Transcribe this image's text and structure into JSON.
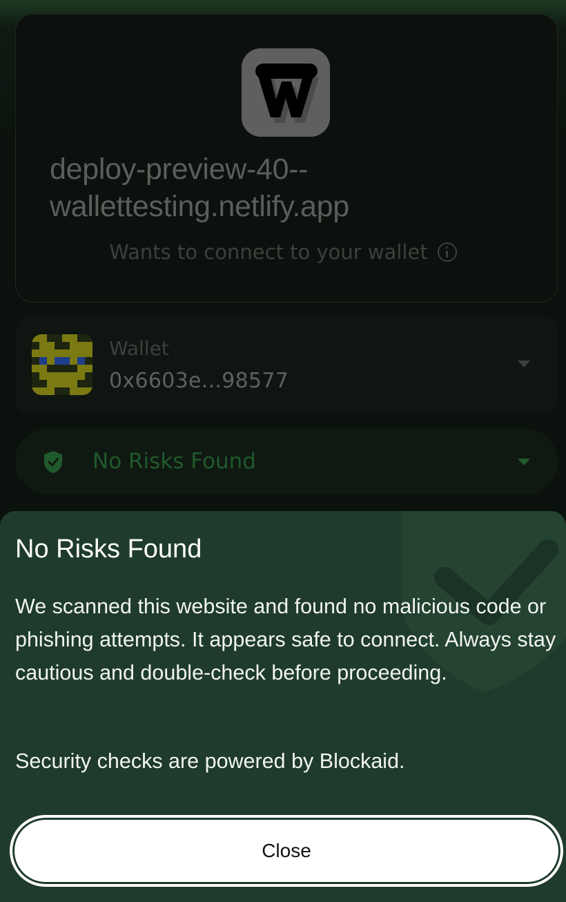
{
  "connection": {
    "app_name": "deploy-preview-40--wallettesting.netlify.app",
    "subtitle": "Wants to connect to your wallet",
    "info_icon": "info-circle-icon",
    "logo_icon": "w-logo-icon"
  },
  "wallet": {
    "label": "Wallet",
    "address": "0x6603e...98577",
    "avatar_icon": "pixel-avatar-icon",
    "chevron_icon": "chevron-down-icon"
  },
  "risk_pill": {
    "label": "No Risks Found",
    "icon": "shield-check-icon",
    "chevron_icon": "chevron-down-icon"
  },
  "sheet": {
    "title": "No Risks Found",
    "body": "We scanned this website and found no malicious code or phishing attempts. It appears safe to connect. Always stay cautious and double-check before proceeding.",
    "note": "Security checks are powered by Blockaid.",
    "close_label": "Close",
    "watermark_icon": "shield-check-icon"
  },
  "colors": {
    "sheet_background": "#1f3b2c",
    "risk_green": "#1f5a2c",
    "button_background": "#ffffff"
  }
}
